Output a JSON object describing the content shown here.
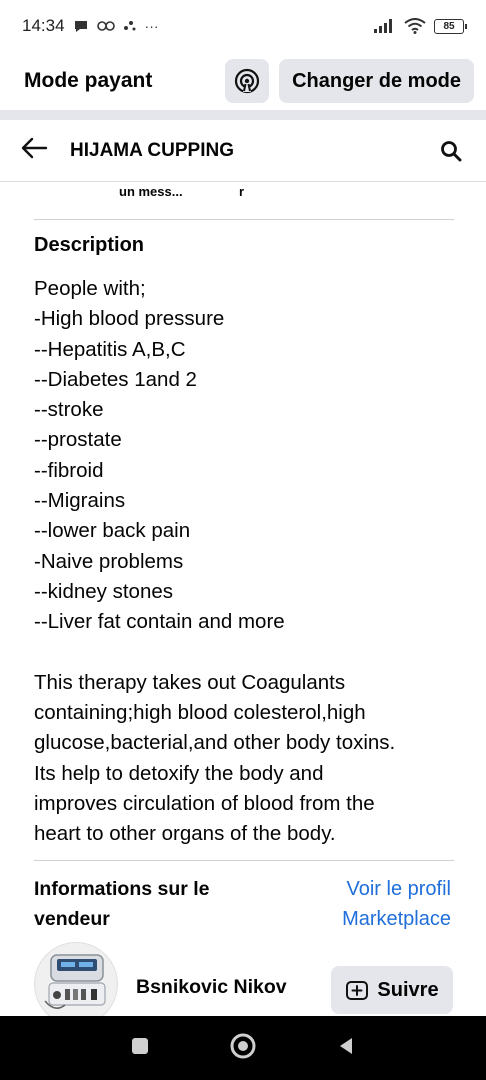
{
  "status_bar": {
    "time": "14:34",
    "battery": "85",
    "extra_icons": "···"
  },
  "mode_bar": {
    "title": "Mode payant",
    "switch_label": "Changer de mode"
  },
  "header": {
    "title": "HIJAMA CUPPING"
  },
  "truncated_labels": {
    "left": "un mess...",
    "right": "r"
  },
  "description": {
    "heading": "Description",
    "lines": [
      "People with;",
      "-High blood pressure",
      "--Hepatitis A,B,C",
      "--Diabetes 1and 2",
      "--stroke",
      "--prostate",
      "--fibroid",
      "--Migrains",
      "--lower back pain",
      "-Naive problems",
      "--kidney stones",
      "--Liver fat contain and more",
      "",
      "This therapy takes out Coagulants",
      "containing;high blood colesterol,high",
      "glucose,bacterial,and other body toxins.",
      "Its help to detoxify the body and",
      "improves circulation of blood from the",
      "heart to other organs of the body."
    ]
  },
  "seller": {
    "heading_line1": "Informations sur le",
    "heading_line2": "vendeur",
    "link_line1": "Voir le profil",
    "link_line2": "Marketplace",
    "name": "Bsnikovic Nikov",
    "follow_label": "Suivre"
  },
  "colors": {
    "link": "#216fdb",
    "button_bg": "#e4e6eb",
    "nav_bg": "#000000"
  },
  "icons": {
    "back": "arrow-left-icon",
    "search": "search-icon",
    "mode": "broadcast-icon",
    "follow": "add-square-icon"
  }
}
